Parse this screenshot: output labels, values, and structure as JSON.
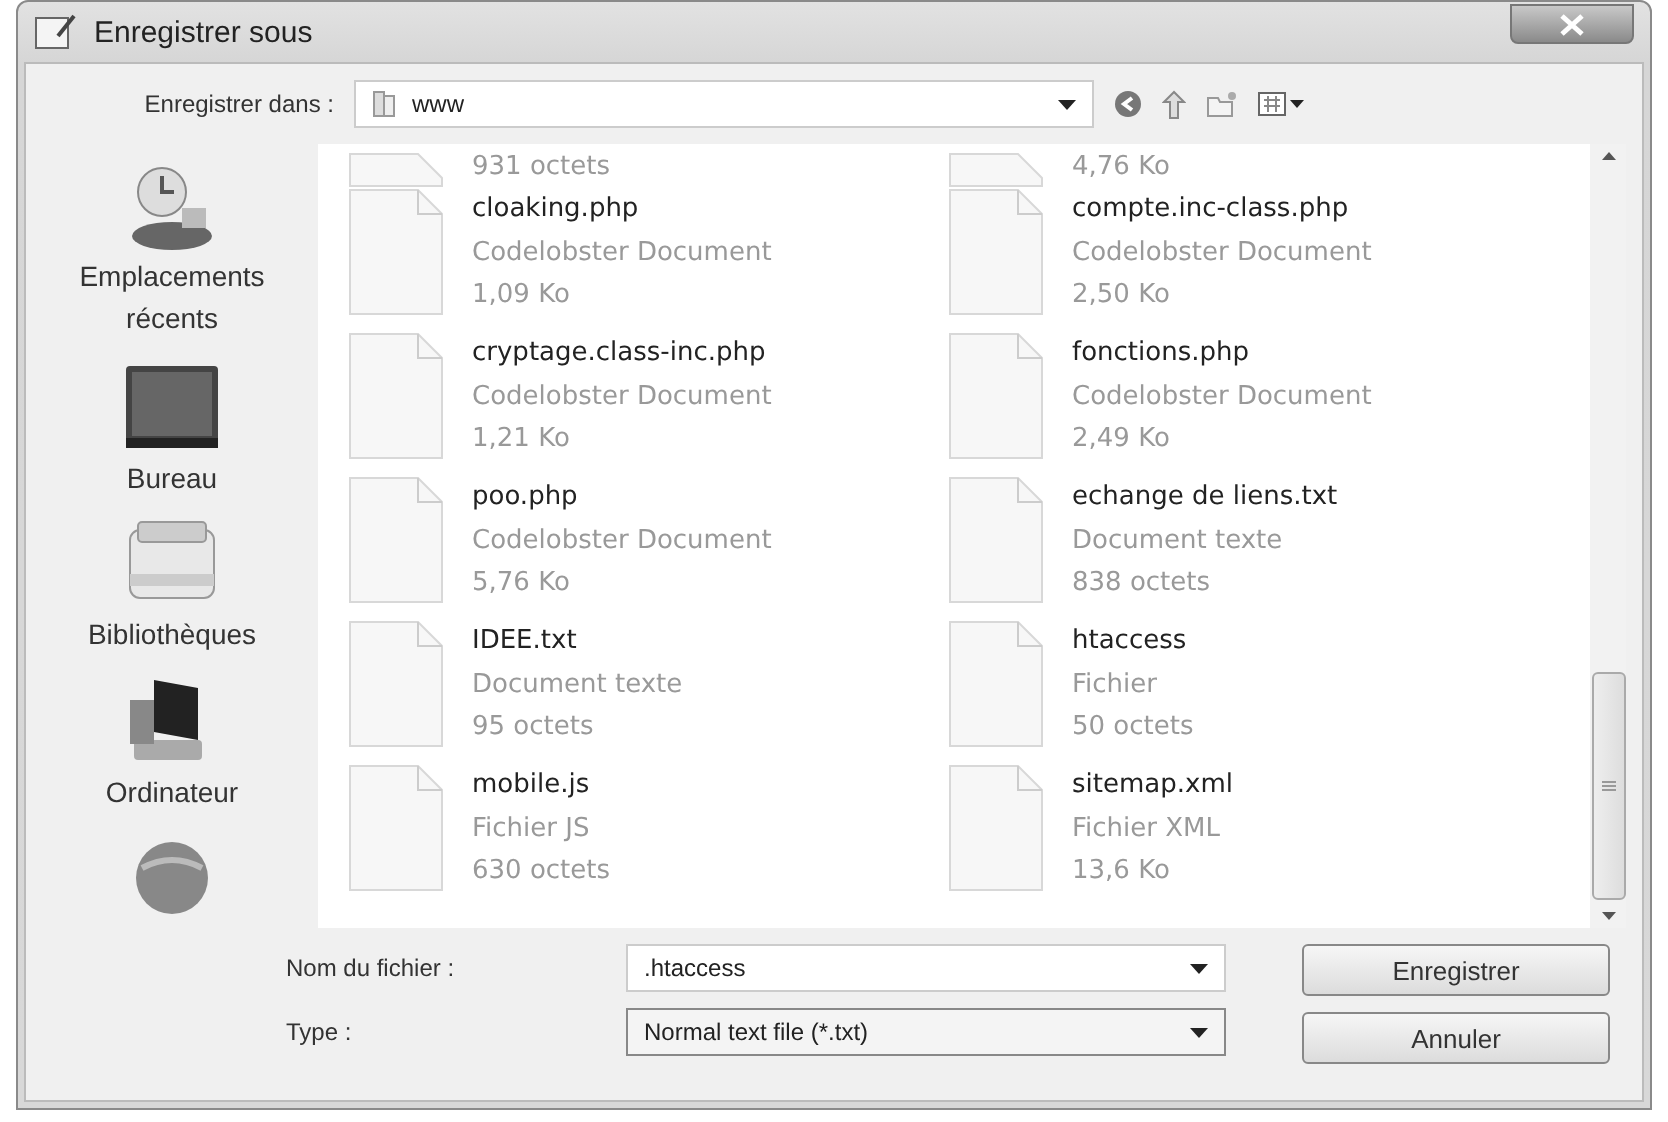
{
  "window": {
    "title": "Enregistrer sous"
  },
  "toolbar": {
    "label": "Enregistrer dans :",
    "location": "www"
  },
  "sidebar": {
    "items": [
      {
        "kind": "recent",
        "label": "Emplacements récents"
      },
      {
        "kind": "desktop",
        "label": "Bureau"
      },
      {
        "kind": "libraries",
        "label": "Bibliothèques"
      },
      {
        "kind": "computer",
        "label": "Ordinateur"
      },
      {
        "kind": "network"
      }
    ]
  },
  "files": [
    {
      "size": "931 octets"
    },
    {
      "size": "4,76 Ko"
    },
    {
      "name": "cloaking.php",
      "type": "Codelobster Document",
      "size": "1,09 Ko"
    },
    {
      "name": "compte.inc-class.php",
      "type": "Codelobster Document",
      "size": "2,50 Ko"
    },
    {
      "name": "cryptage.class-inc.php",
      "type": "Codelobster Document",
      "size": "1,21 Ko"
    },
    {
      "name": "fonctions.php",
      "type": "Codelobster Document",
      "size": "2,49 Ko"
    },
    {
      "name": "poo.php",
      "type": "Codelobster Document",
      "size": "5,76 Ko"
    },
    {
      "name": "echange de liens.txt",
      "type": "Document texte",
      "size": "838 octets"
    },
    {
      "name": "IDEE.txt",
      "type": "Document texte",
      "size": "95 octets"
    },
    {
      "name": "htaccess",
      "type": "Fichier",
      "size": "50 octets"
    },
    {
      "name": "mobile.js",
      "type": "Fichier JS",
      "size": "630 octets"
    },
    {
      "name": "sitemap.xml",
      "type": "Fichier XML",
      "size": "13,6 Ko"
    }
  ],
  "form": {
    "filename_label": "Nom du fichier :",
    "filename": ".htaccess",
    "type_label": "Type :",
    "type": "Normal text file (*.txt)"
  },
  "buttons": [
    "Enregistrer",
    "Annuler"
  ]
}
